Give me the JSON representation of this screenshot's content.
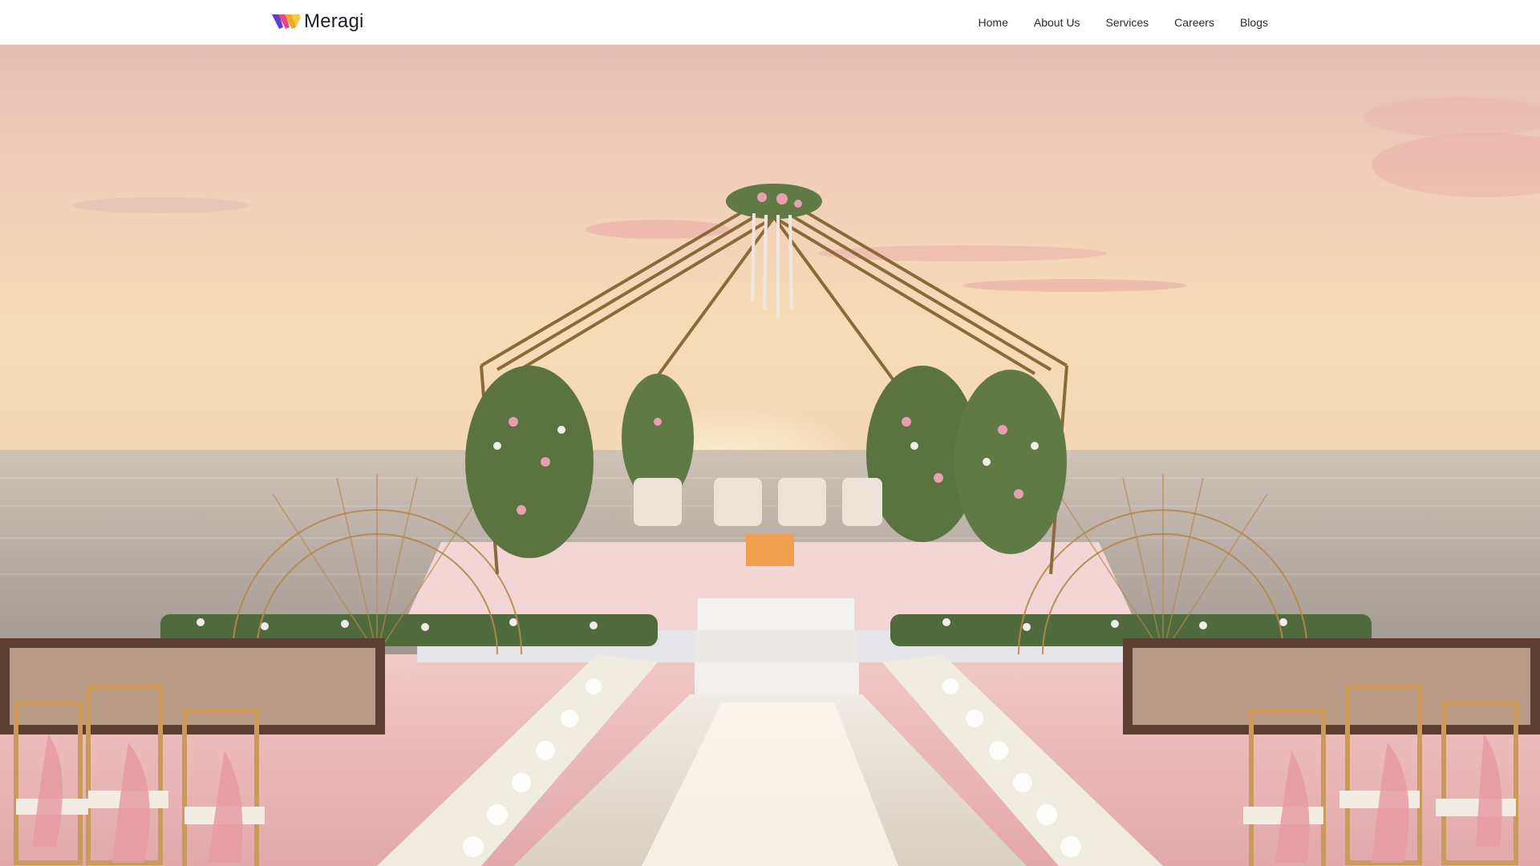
{
  "brand": {
    "name": "Meragi",
    "logo_icon": "meragi-logo-mark",
    "colors": {
      "text": "#1f1f28",
      "mark_purple": "#5b3fd1",
      "mark_orange": "#f5a623",
      "mark_pink": "#e8467c"
    }
  },
  "nav": {
    "items": [
      {
        "label": "Home"
      },
      {
        "label": "About Us"
      },
      {
        "label": "Services"
      },
      {
        "label": "Careers"
      },
      {
        "label": "Blogs"
      }
    ]
  },
  "hero": {
    "image_subject": "hero-wedding-mandap-image",
    "colors": {
      "sky_top": "#e9c3b4",
      "sky_mid": "#f3d3b8",
      "horizon": "#f6d9b2",
      "sea": "#b9aea3",
      "carpet": "#e9b4b5",
      "gold": "#b58a4a"
    }
  }
}
